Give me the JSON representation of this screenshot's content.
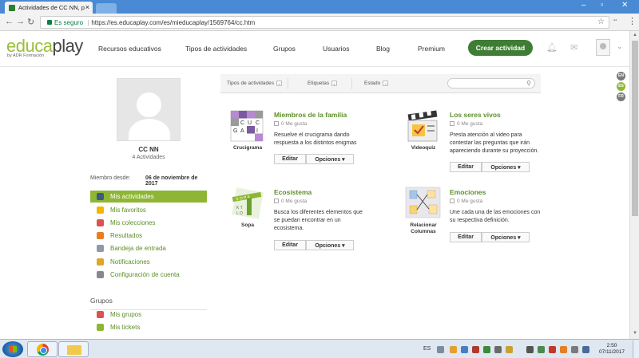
{
  "browser": {
    "tab_title": "Actividades de CC NN, p",
    "url_secure": "Es seguro",
    "url": "https://es.educaplay.com/es/mieducaplay/1569764/cc.htm"
  },
  "header": {
    "logo_a": "educa",
    "logo_b": "play",
    "logo_sub": "by ADR Formación",
    "nav": [
      "Recursos educativos",
      "Tipos de actividades",
      "Grupos",
      "Usuarios",
      "Blog",
      "Premium"
    ],
    "create_label": "Crear actividad"
  },
  "languages": [
    {
      "code": "EN",
      "color": "#7a7a7a"
    },
    {
      "code": "ES",
      "color": "#8eb634"
    },
    {
      "code": "FR",
      "color": "#7a7a7a"
    }
  ],
  "profile": {
    "name": "CC NN",
    "count": "4 Actividades",
    "member_label": "Miembro desde:",
    "member_date": "06 de noviembre de 2017"
  },
  "sidebar": {
    "items": [
      {
        "label": "Mis actividades",
        "active": true,
        "icon": "folder-icon",
        "color": "#3d5a80"
      },
      {
        "label": "Mis favoritos",
        "icon": "star-icon",
        "color": "#f4b400"
      },
      {
        "label": "Mis colecciones",
        "icon": "collection-icon",
        "color": "#d9534f"
      },
      {
        "label": "Resultados",
        "icon": "bar-chart-icon",
        "color": "#e67e22"
      },
      {
        "label": "Bandeja de entrada",
        "icon": "inbox-icon",
        "color": "#8e9aa8"
      },
      {
        "label": "Notificaciones",
        "icon": "bell-icon",
        "color": "#e0a526"
      },
      {
        "label": "Configuración de cuenta",
        "icon": "wrench-icon",
        "color": "#888888"
      }
    ],
    "groups_title": "Grupos",
    "group_items": [
      {
        "label": "Mis grupos",
        "icon": "group-icon",
        "color": "#d9534f"
      },
      {
        "label": "Mis tickets",
        "icon": "ticket-icon",
        "color": "#8eb634"
      }
    ]
  },
  "filters": {
    "types": "Tipos de actividades",
    "tags": "Etiquetas",
    "state": "Estado",
    "search_placeholder": ""
  },
  "activities": [
    {
      "title": "Miembros de la familia",
      "type": "Crucigrama",
      "likes": "0 Me gusta",
      "desc": "Resuelve el crucigrama dando respuesta a los distintos enigmas",
      "edit": "Editar",
      "options": "Opciones"
    },
    {
      "title": "Los seres vivos",
      "type": "Videoquiz",
      "likes": "0 Me gusta",
      "desc": "Presta atención al video para contestar las preguntas que irán apareciendo durante su proyección.",
      "edit": "Editar",
      "options": "Opciones"
    },
    {
      "title": "Ecosistema",
      "type": "Sopa",
      "likes": "0 Me gusta",
      "desc": "Busca los diferentes elementos que se puedan encontrar en un ecosistema.",
      "edit": "Editar",
      "options": "Opciones"
    },
    {
      "title": "Emociones",
      "type": "Relacionar Columnas",
      "likes": "0 Me gusta",
      "desc": "Une cada una de las emociones con su respectiva definición.",
      "edit": "Editar",
      "options": "Opciones"
    }
  ],
  "taskbar": {
    "lang": "ES",
    "time": "2:50",
    "date": "07/11/2017"
  }
}
